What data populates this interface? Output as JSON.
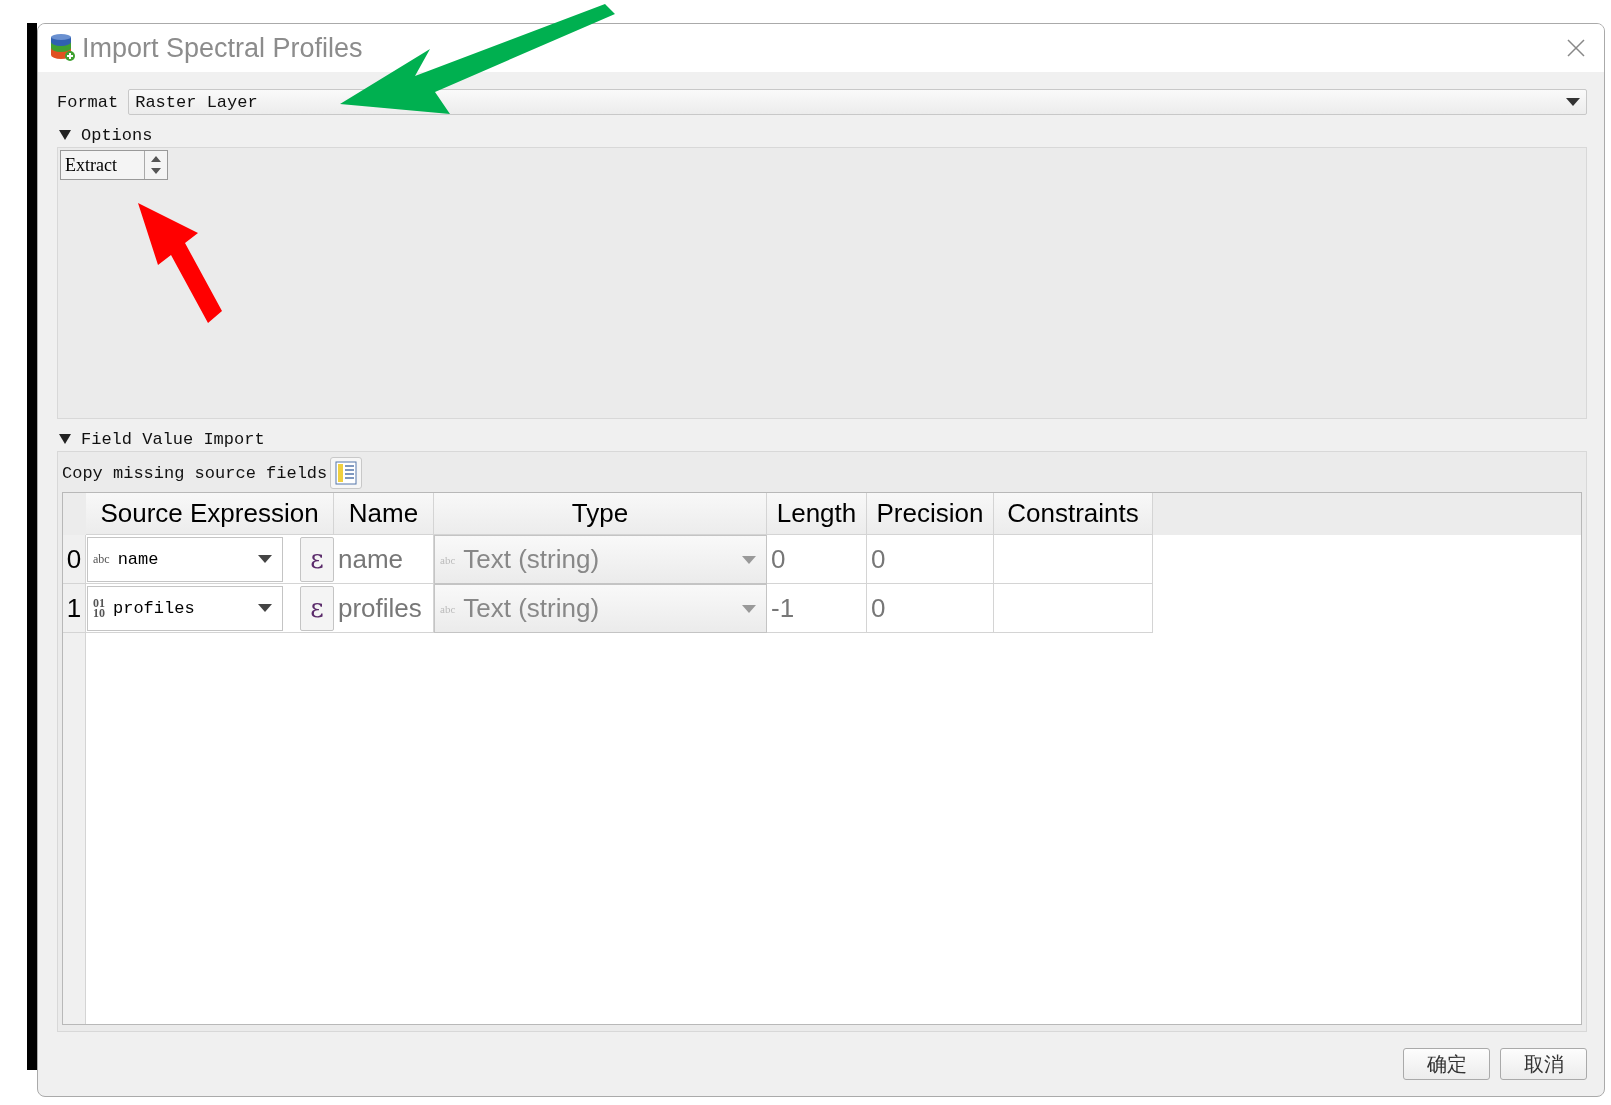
{
  "window": {
    "title": "Import Spectral Profiles"
  },
  "format": {
    "label": "Format",
    "value": "Raster Layer"
  },
  "options": {
    "label": "Options",
    "expanded": true,
    "spinbox_value": "Extract"
  },
  "field_value_import": {
    "label": "Field Value Import",
    "expanded": true,
    "copy_label": "Copy missing source fields"
  },
  "table": {
    "columns": [
      "Source Expression",
      "Name",
      "Type",
      "Length",
      "Precision",
      "Constraints"
    ],
    "rows": [
      {
        "index": "0",
        "source_icon": [
          "abc"
        ],
        "source": "name",
        "expression_button": "ε",
        "name": "name",
        "type_icon": "abc",
        "type": "Text (string)",
        "length": "0",
        "precision": "0"
      },
      {
        "index": "1",
        "source_icon": [
          "01",
          "10"
        ],
        "source": "profiles",
        "expression_button": "ε",
        "name": "profiles",
        "type_icon": "abc",
        "type": "Text (string)",
        "length": "-1",
        "precision": "0"
      }
    ]
  },
  "buttons": [
    "确定",
    "取消"
  ],
  "annotations": [
    {
      "kind": "arrow",
      "color": "#00b050"
    },
    {
      "kind": "arrow",
      "color": "#ff0000"
    }
  ]
}
